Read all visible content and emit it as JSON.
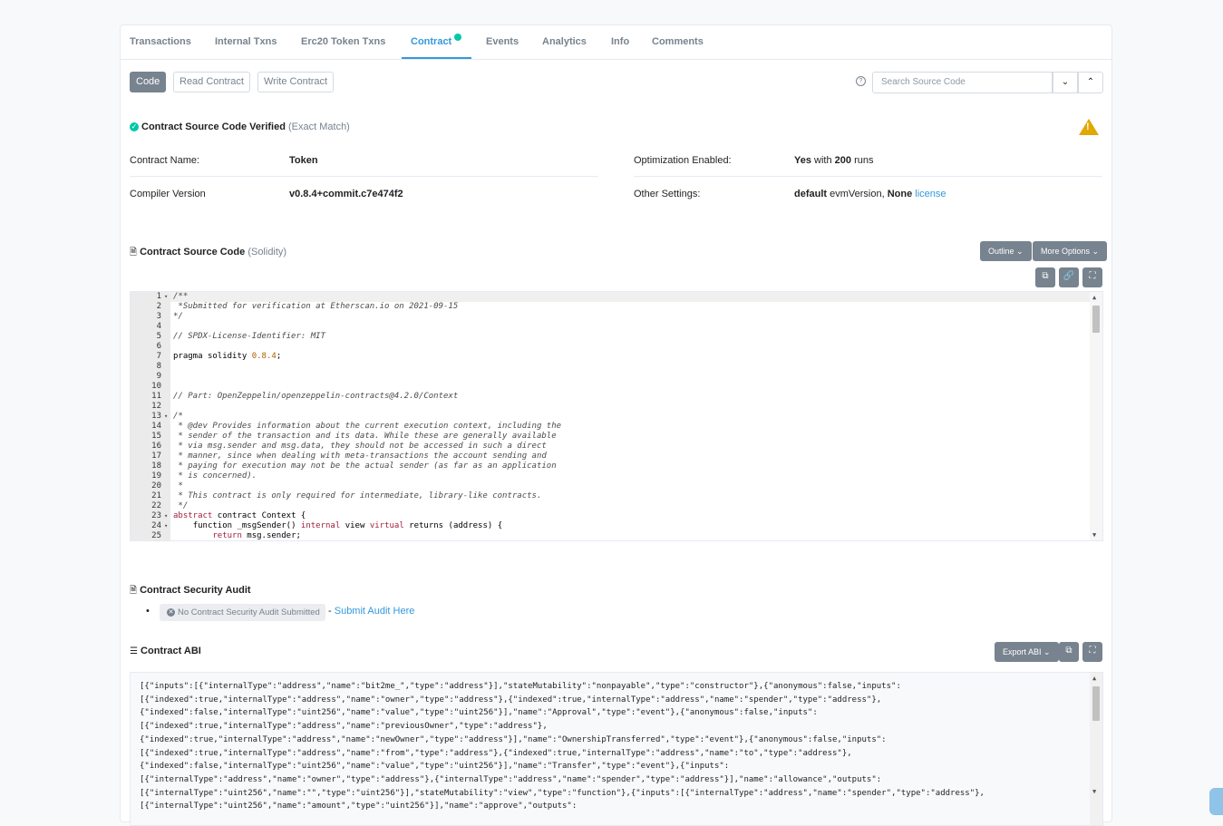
{
  "tabs": [
    {
      "label": "Transactions"
    },
    {
      "label": "Internal Txns"
    },
    {
      "label": "Erc20 Token Txns"
    },
    {
      "label": "Contract"
    },
    {
      "label": "Events"
    },
    {
      "label": "Analytics"
    },
    {
      "label": "Info"
    },
    {
      "label": "Comments"
    }
  ],
  "subtabs": {
    "code": "Code",
    "read": "Read Contract",
    "write": "Write Contract"
  },
  "search": {
    "placeholder": "Search Source Code"
  },
  "verified": {
    "title": "Contract Source Code Verified",
    "match": "(Exact Match)"
  },
  "details": {
    "contract_name_label": "Contract Name:",
    "contract_name": "Token",
    "compiler_label": "Compiler Version",
    "compiler": "v0.8.4+commit.c7e474f2",
    "optimization_label": "Optimization Enabled:",
    "opt_yes": "Yes",
    "opt_with": "with",
    "opt_runs": "200",
    "opt_runs_word": "runs",
    "other_label": "Other Settings:",
    "other_default": "default",
    "other_evm": "evmVersion,",
    "other_none": "None",
    "other_license": "license"
  },
  "source": {
    "title": "Contract Source Code",
    "lang": "(Solidity)",
    "outline": "Outline",
    "more_options": "More Options",
    "lines": [
      "/**",
      " *Submitted for verification at Etherscan.io on 2021-09-15",
      "*/",
      "",
      "// SPDX-License-Identifier: MIT",
      "",
      "pragma solidity 0.8.4;",
      "",
      "",
      "",
      "// Part: OpenZeppelin/openzeppelin-contracts@4.2.0/Context",
      "",
      "/*",
      " * @dev Provides information about the current execution context, including the",
      " * sender of the transaction and its data. While these are generally available",
      " * via msg.sender and msg.data, they should not be accessed in such a direct",
      " * manner, since when dealing with meta-transactions the account sending and",
      " * paying for execution may not be the actual sender (as far as an application",
      " * is concerned).",
      " *",
      " * This contract is only required for intermediate, library-like contracts.",
      " */",
      "abstract contract Context {",
      "    function _msgSender() internal view virtual returns (address) {",
      "        return msg.sender;"
    ]
  },
  "audit": {
    "title": "Contract Security Audit",
    "badge": "No Contract Security Audit Submitted",
    "dash": "-",
    "link": "Submit Audit Here"
  },
  "abi": {
    "title": "Contract ABI",
    "export": "Export ABI",
    "lines": [
      "[{\"inputs\":[{\"internalType\":\"address\",\"name\":\"bit2me_\",\"type\":\"address\"}],\"stateMutability\":\"nonpayable\",\"type\":\"constructor\"},{\"anonymous\":false,\"inputs\":",
      "[{\"indexed\":true,\"internalType\":\"address\",\"name\":\"owner\",\"type\":\"address\"},{\"indexed\":true,\"internalType\":\"address\",\"name\":\"spender\",\"type\":\"address\"},",
      "{\"indexed\":false,\"internalType\":\"uint256\",\"name\":\"value\",\"type\":\"uint256\"}],\"name\":\"Approval\",\"type\":\"event\"},{\"anonymous\":false,\"inputs\":",
      "[{\"indexed\":true,\"internalType\":\"address\",\"name\":\"previousOwner\",\"type\":\"address\"},",
      "{\"indexed\":true,\"internalType\":\"address\",\"name\":\"newOwner\",\"type\":\"address\"}],\"name\":\"OwnershipTransferred\",\"type\":\"event\"},{\"anonymous\":false,\"inputs\":",
      "[{\"indexed\":true,\"internalType\":\"address\",\"name\":\"from\",\"type\":\"address\"},{\"indexed\":true,\"internalType\":\"address\",\"name\":\"to\",\"type\":\"address\"},",
      "{\"indexed\":false,\"internalType\":\"uint256\",\"name\":\"value\",\"type\":\"uint256\"}],\"name\":\"Transfer\",\"type\":\"event\"},{\"inputs\":",
      "[{\"internalType\":\"address\",\"name\":\"owner\",\"type\":\"address\"},{\"internalType\":\"address\",\"name\":\"spender\",\"type\":\"address\"}],\"name\":\"allowance\",\"outputs\":",
      "[{\"internalType\":\"uint256\",\"name\":\"\",\"type\":\"uint256\"}],\"stateMutability\":\"view\",\"type\":\"function\"},{\"inputs\":[{\"internalType\":\"address\",\"name\":\"spender\",\"type\":\"address\"},",
      "[{\"internalType\":\"uint256\",\"name\":\"amount\",\"type\":\"uint256\"}],\"name\":\"approve\",\"outputs\":"
    ]
  }
}
